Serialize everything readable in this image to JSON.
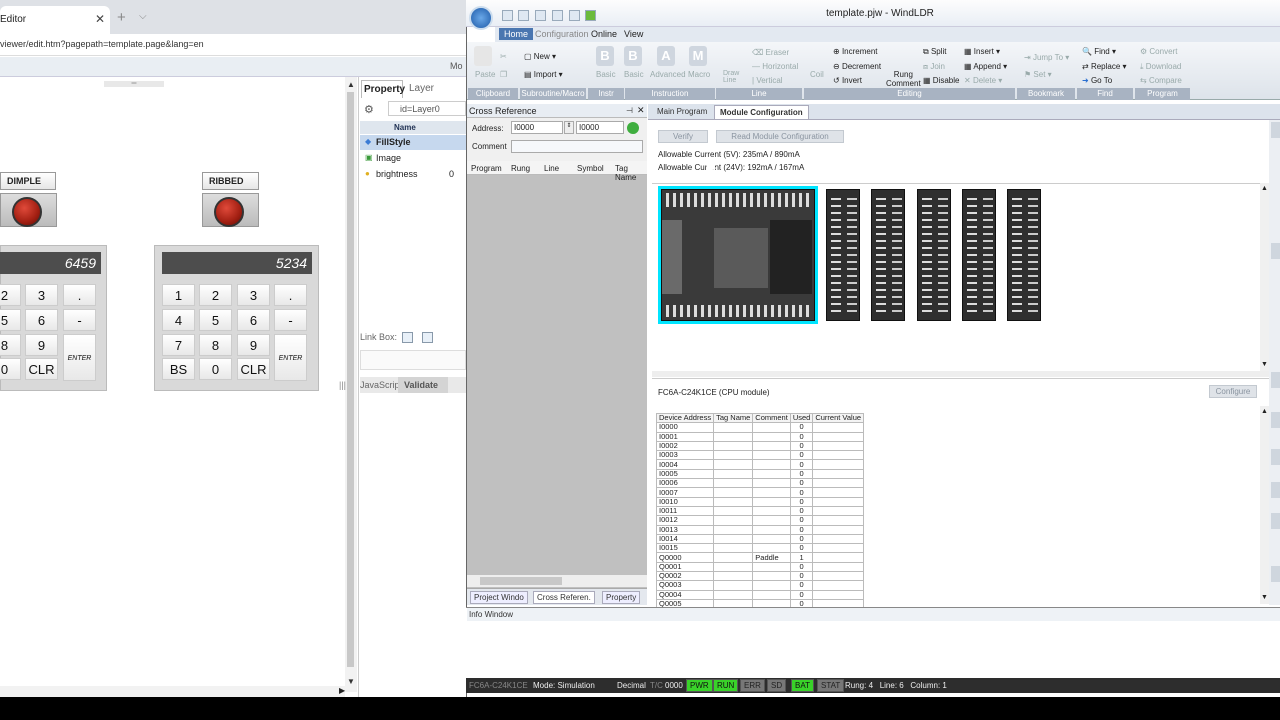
{
  "browser": {
    "tab_title": "Editor",
    "tab_close": "✕",
    "new_tab": "+",
    "tab_menu": "⌵",
    "address": "viewer/edit.htm?pagepath=template.page&lang=en",
    "toolbar_fragment": "Mo"
  },
  "canvas": {
    "handle": "═",
    "buttons": [
      {
        "label": "DIMPLE"
      },
      {
        "label": "RIBBED"
      }
    ],
    "keypad_left": {
      "display": "6459",
      "keys": [
        "2",
        "3",
        ".",
        "5",
        "6",
        "-",
        "8",
        "9",
        "0",
        "CLR"
      ],
      "enter": "ENTER"
    },
    "keypad_right": {
      "display": "5234",
      "keys": [
        "1",
        "2",
        "3",
        ".",
        "4",
        "5",
        "6",
        "-",
        "7",
        "8",
        "9",
        "BS",
        "0",
        "CLR"
      ],
      "enter": "ENTER"
    }
  },
  "props": {
    "tab_property": "Property",
    "tab_layer": "Layer",
    "id_value": "id=Layer0",
    "col_name": "Name",
    "rows": [
      {
        "name": "FillStyle",
        "value": ""
      },
      {
        "name": "Image",
        "value": ""
      },
      {
        "name": "brightness",
        "value": "0"
      }
    ],
    "link_box": "Link Box:",
    "js_tab": "JavaScript",
    "validate_tab": "Validate"
  },
  "windldr": {
    "title": "template.pjw - WindLDR",
    "menu": [
      "Home",
      "Configuration",
      "Online",
      "View"
    ],
    "ribbon": {
      "paste": "Paste",
      "new": "New",
      "import": "Import",
      "basic1": "Basic",
      "basic2": "Basic",
      "advanced": "Advanced",
      "macro": "Macro",
      "draw_line": "Draw\nLine",
      "eraser": "Eraser",
      "horizontal": "Horizontal",
      "vertical": "Vertical",
      "coil": "Coil",
      "increment": "Increment",
      "decrement": "Decrement",
      "invert": "Invert",
      "rung_comment": "Rung\nComment",
      "split": "Split",
      "join": "Join",
      "disable": "Disable",
      "insert": "Insert",
      "append": "Append",
      "delete": "Delete",
      "jump_to": "Jump To",
      "set": "Set",
      "find": "Find",
      "replace": "Replace",
      "go_to": "Go To",
      "convert": "Convert",
      "download": "Download",
      "compare": "Compare",
      "groups": [
        "Clipboard",
        "Subroutine/Macro",
        "Instr",
        "Instruction",
        "Line",
        "Editing",
        "Bookmark",
        "Find",
        "Program"
      ]
    },
    "xref": {
      "title": "Cross Reference",
      "address_label": "Address:",
      "address_from": "I0000",
      "address_to": "I0000",
      "comment_label": "Comment",
      "columns": [
        "Program",
        "Rung",
        "Line",
        "Symbol",
        "Tag Name"
      ],
      "bottom_tabs": [
        "Project Windo",
        "Cross Referen.",
        "Property"
      ]
    },
    "doc_tabs": [
      "Main Program",
      "Module Configuration"
    ],
    "verify": "Verify",
    "read_module": "Read Module Configuration",
    "current_5v": "Allowable Current (5V): 235mA / 890mA",
    "current_24v": "Allowable Current (24V): 192mA / 167mA",
    "cpu_module_label": "FC6A-C24K1CE (CPU module)",
    "configure": "Configure",
    "table": {
      "headers": [
        "Device Address",
        "Tag Name",
        "Comment",
        "Used",
        "Current Value"
      ],
      "rows": [
        [
          "I0000",
          "",
          "",
          "0",
          ""
        ],
        [
          "I0001",
          "",
          "",
          "0",
          ""
        ],
        [
          "I0002",
          "",
          "",
          "0",
          ""
        ],
        [
          "I0003",
          "",
          "",
          "0",
          ""
        ],
        [
          "I0004",
          "",
          "",
          "0",
          ""
        ],
        [
          "I0005",
          "",
          "",
          "0",
          ""
        ],
        [
          "I0006",
          "",
          "",
          "0",
          ""
        ],
        [
          "I0007",
          "",
          "",
          "0",
          ""
        ],
        [
          "I0010",
          "",
          "",
          "0",
          ""
        ],
        [
          "I0011",
          "",
          "",
          "0",
          ""
        ],
        [
          "I0012",
          "",
          "",
          "0",
          ""
        ],
        [
          "I0013",
          "",
          "",
          "0",
          ""
        ],
        [
          "I0014",
          "",
          "",
          "0",
          ""
        ],
        [
          "I0015",
          "",
          "",
          "0",
          ""
        ],
        [
          "Q0000",
          "",
          "Paddle",
          "1",
          ""
        ],
        [
          "Q0001",
          "",
          "",
          "0",
          ""
        ],
        [
          "Q0002",
          "",
          "",
          "0",
          ""
        ],
        [
          "Q0003",
          "",
          "",
          "0",
          ""
        ],
        [
          "Q0004",
          "",
          "",
          "0",
          ""
        ],
        [
          "Q0005",
          "",
          "",
          "0",
          ""
        ]
      ]
    },
    "info_window": "Info Window",
    "status": {
      "cpu": "FC6A-C24K1CE",
      "mode": "Mode: Simulation",
      "base": "Decimal",
      "tc_label": "T/C",
      "tc_value": "0000",
      "leds": [
        "PWR",
        "RUN",
        "ERR",
        "SD",
        "BAT",
        "STAT"
      ],
      "position": "Rung: 4   Line: 6   Column: 1"
    }
  }
}
